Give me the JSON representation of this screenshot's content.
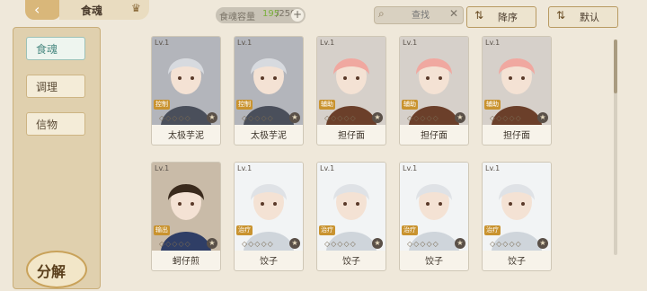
{
  "header": {
    "back_icon": "back-arrow-icon",
    "title": "食魂"
  },
  "capacity": {
    "label": "食魂容量",
    "current": "195",
    "max": "/250",
    "plus": "+"
  },
  "search": {
    "placeholder": "查找",
    "clear": "✕"
  },
  "sort": {
    "order_label": "降序",
    "default_label": "默认"
  },
  "sidebar": {
    "items": [
      {
        "label": "食魂"
      },
      {
        "label": "调理"
      },
      {
        "label": "信物"
      }
    ],
    "decompose_label": "分解"
  },
  "cards": [
    {
      "level": "Lv.1",
      "role": "控制",
      "name": "太极芋泥",
      "palette": "ink"
    },
    {
      "level": "Lv.1",
      "role": "控制",
      "name": "太极芋泥",
      "palette": "ink"
    },
    {
      "level": "Lv.1",
      "role": "辅助",
      "name": "担仔面",
      "palette": "pink"
    },
    {
      "level": "Lv.1",
      "role": "辅助",
      "name": "担仔面",
      "palette": "pink"
    },
    {
      "level": "Lv.1",
      "role": "辅助",
      "name": "担仔面",
      "palette": "pink"
    },
    {
      "level": "Lv.1",
      "role": "输出",
      "name": "蚵仔煎",
      "palette": "straw"
    },
    {
      "level": "Lv.1",
      "role": "治疗",
      "name": "饺子",
      "palette": "white"
    },
    {
      "level": "Lv.1",
      "role": "治疗",
      "name": "饺子",
      "palette": "white"
    },
    {
      "level": "Lv.1",
      "role": "治疗",
      "name": "饺子",
      "palette": "white"
    },
    {
      "level": "Lv.1",
      "role": "治疗",
      "name": "饺子",
      "palette": "white"
    }
  ]
}
